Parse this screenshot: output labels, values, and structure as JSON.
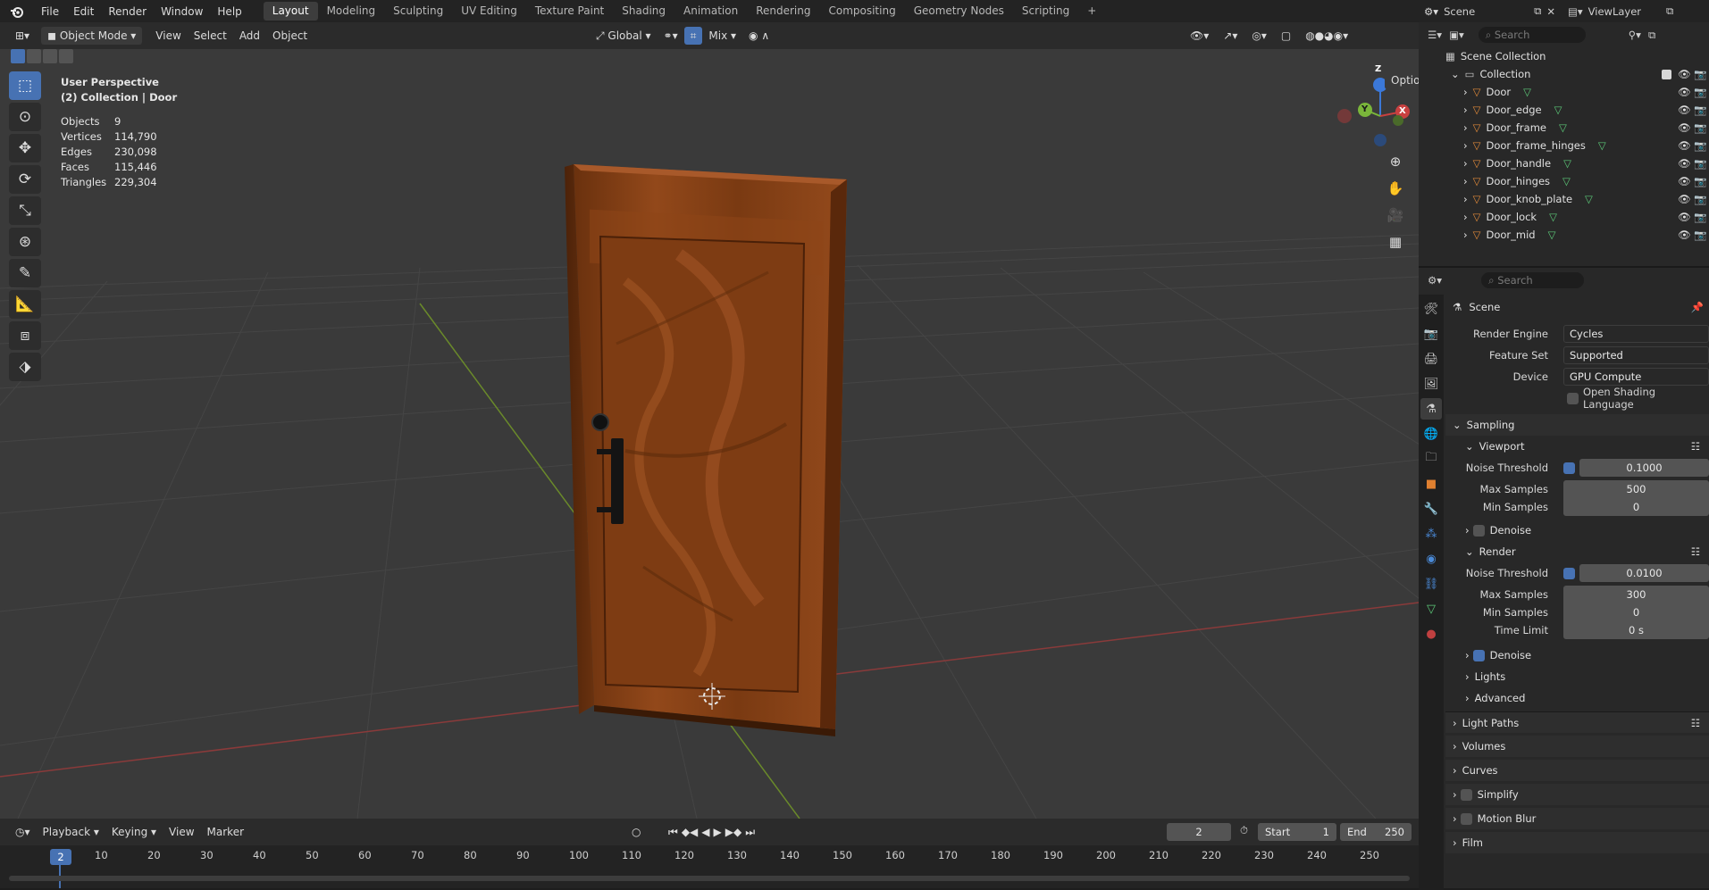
{
  "topbar": {
    "menus": [
      "File",
      "Edit",
      "Render",
      "Window",
      "Help"
    ],
    "workspaces": [
      "Layout",
      "Modeling",
      "Sculpting",
      "UV Editing",
      "Texture Paint",
      "Shading",
      "Animation",
      "Rendering",
      "Compositing",
      "Geometry Nodes",
      "Scripting"
    ],
    "active_workspace": "Layout",
    "add_tab": "+",
    "scene_name": "Scene",
    "view_layer": "ViewLayer"
  },
  "header": {
    "mode": "Object Mode",
    "menus": [
      "View",
      "Select",
      "Add",
      "Object"
    ],
    "orientation": "Global",
    "snap": "Mix",
    "options": "Options"
  },
  "overlay": {
    "view_name": "User Perspective",
    "collection_line": "(2) Collection | Door",
    "stats": [
      {
        "label": "Objects",
        "value": "9"
      },
      {
        "label": "Vertices",
        "value": "114,790"
      },
      {
        "label": "Edges",
        "value": "230,098"
      },
      {
        "label": "Faces",
        "value": "115,446"
      },
      {
        "label": "Triangles",
        "value": "229,304"
      }
    ]
  },
  "gizmo": {
    "z": "Z",
    "y": "Y",
    "x": "X"
  },
  "outliner": {
    "search_placeholder": "Search",
    "scene_collection": "Scene Collection",
    "collection": "Collection",
    "objects": [
      "Door",
      "Door_edge",
      "Door_frame",
      "Door_frame_hinges",
      "Door_handle",
      "Door_hinges",
      "Door_knob_plate",
      "Door_lock",
      "Door_mid"
    ]
  },
  "properties": {
    "search_placeholder": "Search",
    "context": "Scene",
    "render_engine_label": "Render Engine",
    "render_engine": "Cycles",
    "feature_set_label": "Feature Set",
    "feature_set": "Supported",
    "device_label": "Device",
    "device": "GPU Compute",
    "osl_label": "Open Shading Language",
    "sampling": "Sampling",
    "viewport": "Viewport",
    "noise_threshold_label": "Noise Threshold",
    "viewport_noise": "0.1000",
    "max_samples_label": "Max Samples",
    "viewport_max": "500",
    "min_samples_label": "Min Samples",
    "viewport_min": "0",
    "denoise_label": "Denoise",
    "render": "Render",
    "render_noise": "0.0100",
    "render_max": "300",
    "render_min": "0",
    "time_limit_label": "Time Limit",
    "time_limit": "0 s",
    "lights": "Lights",
    "advanced": "Advanced",
    "light_paths": "Light Paths",
    "volumes": "Volumes",
    "curves": "Curves",
    "simplify": "Simplify",
    "motion_blur": "Motion Blur",
    "film": "Film"
  },
  "timeline": {
    "menus": [
      "Playback",
      "Keying",
      "View",
      "Marker"
    ],
    "current_frame": "2",
    "start_label": "Start",
    "start": "1",
    "end_label": "End",
    "end": "250",
    "ticks": [
      "10",
      "20",
      "30",
      "40",
      "50",
      "60",
      "70",
      "80",
      "90",
      "100",
      "110",
      "120",
      "130",
      "140",
      "150",
      "160",
      "170",
      "180",
      "190",
      "200",
      "210",
      "220",
      "230",
      "240",
      "250"
    ]
  },
  "colors": {
    "accent": "#4772b3",
    "grid_x_axis": "#8a3a3a",
    "grid_y_axis": "#6a8a2a",
    "wood": "#8a4317",
    "wood_dark": "#5e2b0c"
  }
}
